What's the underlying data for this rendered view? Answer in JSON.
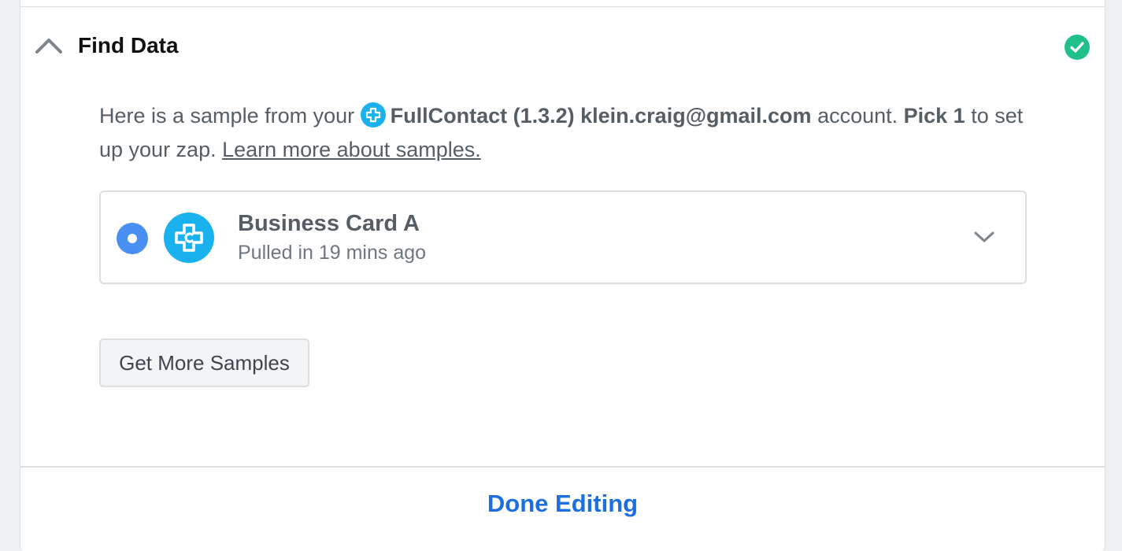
{
  "section": {
    "title": "Find Data",
    "status": "complete"
  },
  "description": {
    "prefix": "Here is a sample from your ",
    "account": "FullContact (1.3.2) klein.craig@gmail.com",
    "mid": " account. ",
    "pick": "Pick 1",
    "suffix": " to set up your zap. ",
    "link": "Learn more about samples."
  },
  "sample": {
    "title": "Business Card A",
    "subtitle": "Pulled in 19 mins ago",
    "selected": true
  },
  "buttons": {
    "get_more": "Get More Samples",
    "done": "Done Editing"
  },
  "colors": {
    "accent": "#1d6fe0",
    "success": "#1fc08b",
    "radio": "#4a90f2",
    "fullcontact": "#19b2ef"
  },
  "icons": {
    "collapse": "chevron-up-icon",
    "status": "check-circle-icon",
    "app": "fullcontact-logo-icon",
    "expand": "chevron-down-icon"
  }
}
